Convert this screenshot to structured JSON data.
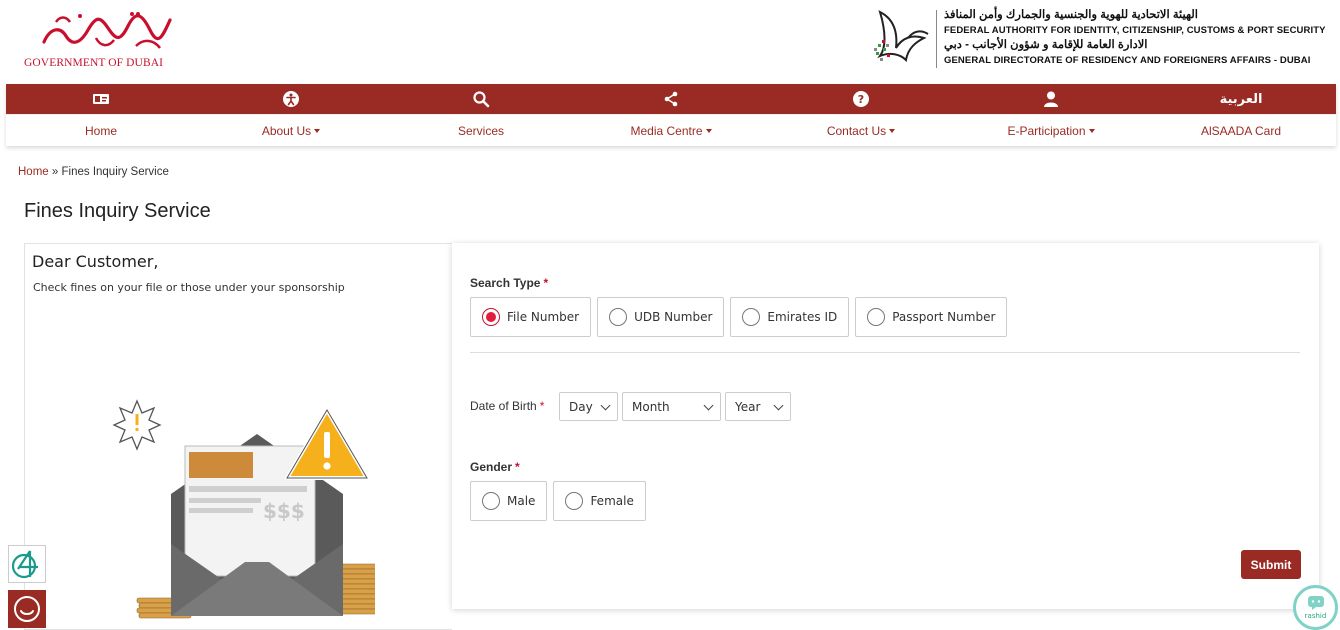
{
  "header": {
    "gov_logo_text": "GOVERNMENT OF DUBAI",
    "gov_logo_arabic": "حكومة دبي",
    "authority_lines": [
      {
        "lang": "ar",
        "text": "الهيئة الاتحادية للهوية والجنسية والجمارك وأمن المنافذ"
      },
      {
        "lang": "en",
        "text": "FEDERAL AUTHORITY FOR IDENTITY, CITIZENSHIP, CUSTOMS & PORT SECURITY"
      },
      {
        "lang": "ar",
        "text": "الادارة العامة للإقامة و شؤون الأجانب - دبي"
      },
      {
        "lang": "en",
        "text": "GENERAL DIRECTORATE OF RESIDENCY AND FOREIGNERS AFFAIRS - DUBAI"
      }
    ]
  },
  "nav": {
    "language_link": "العربية",
    "items": [
      {
        "label": "Home",
        "icon": "id-card-icon",
        "has_dropdown": false
      },
      {
        "label": "About Us",
        "icon": "accessibility-icon",
        "has_dropdown": true
      },
      {
        "label": "Services",
        "icon": "search-icon",
        "has_dropdown": false
      },
      {
        "label": "Media Centre",
        "icon": "share-icon",
        "has_dropdown": true
      },
      {
        "label": "Contact Us",
        "icon": "help-icon",
        "has_dropdown": true
      },
      {
        "label": "E-Participation",
        "icon": "user-icon",
        "has_dropdown": true
      },
      {
        "label": "AlSAADA Card",
        "icon": "",
        "has_dropdown": false
      }
    ]
  },
  "breadcrumb": {
    "home": "Home",
    "separator": "»",
    "current": "Fines Inquiry Service"
  },
  "page_title": "Fines Inquiry Service",
  "intro": {
    "greeting": "Dear Customer,",
    "text": "Check fines on your file or those under your sponsorship",
    "illustration_text": "$$$"
  },
  "form": {
    "search_type": {
      "label": "Search Type",
      "required_mark": "*",
      "options": [
        "File Number",
        "UDB Number",
        "Emirates ID",
        "Passport Number"
      ],
      "selected": "File Number"
    },
    "dob": {
      "label": "Date of Birth",
      "required_mark": "*",
      "day_placeholder": "Day",
      "month_placeholder": "Month",
      "year_placeholder": "Year"
    },
    "gender": {
      "label": "Gender",
      "required_mark": "*",
      "options": [
        "Male",
        "Female"
      ]
    },
    "submit_label": "Submit"
  },
  "widgets": {
    "rashid_label": "rashid"
  },
  "colors": {
    "brand": "#9a2b24",
    "required": "#c8102e",
    "radio_selected": "#e31c3d"
  }
}
